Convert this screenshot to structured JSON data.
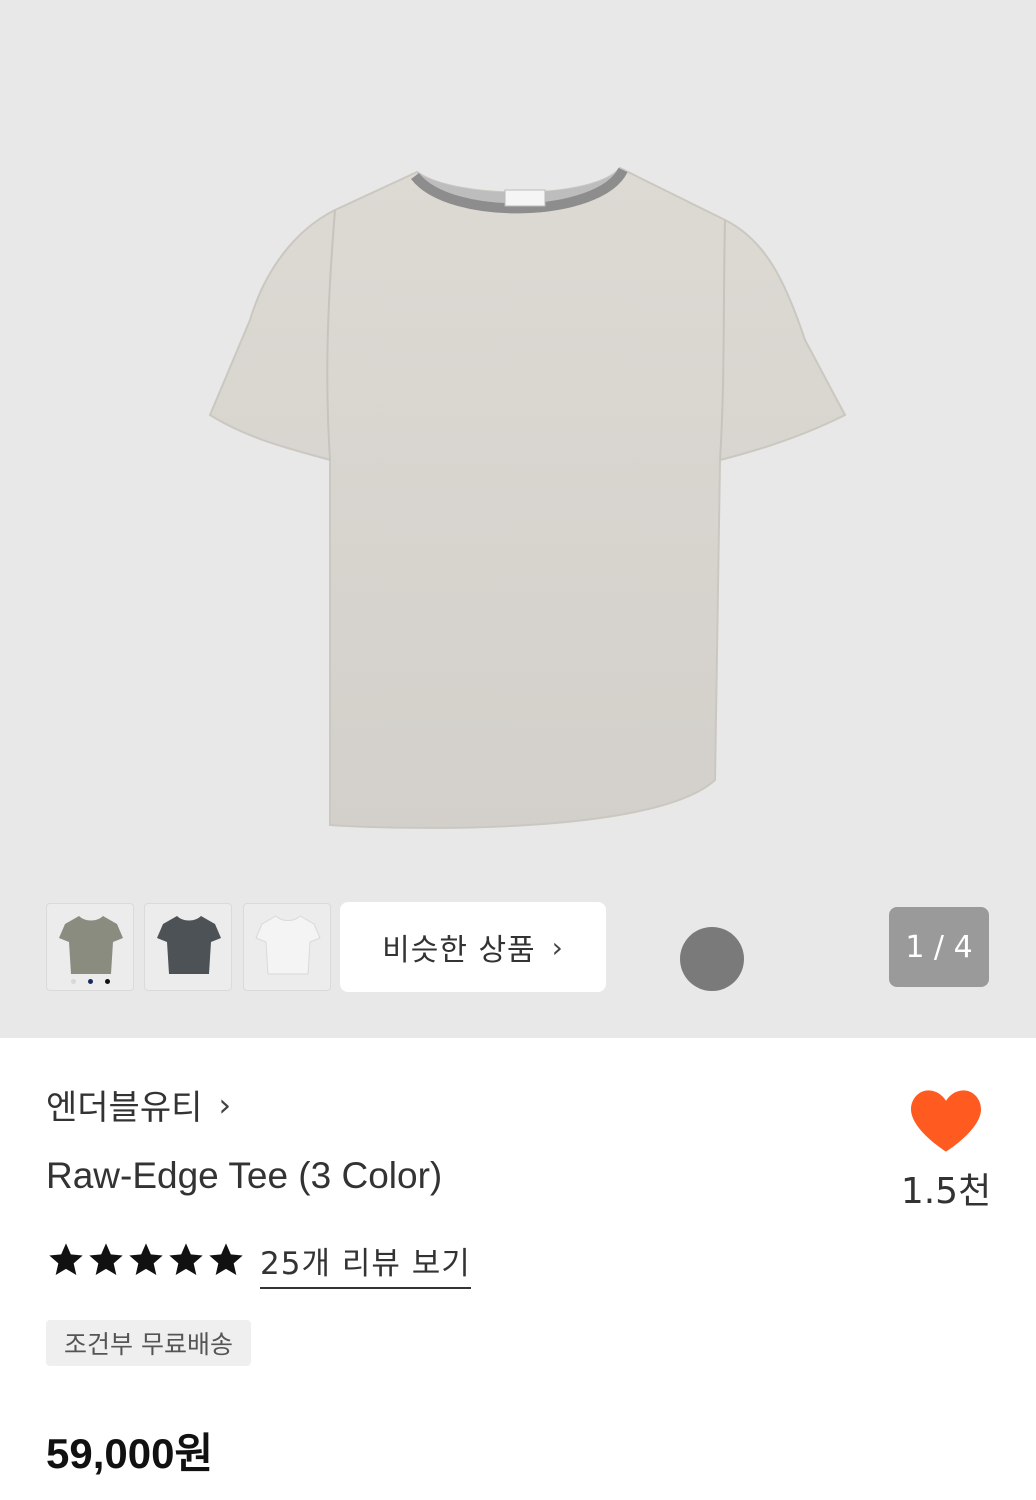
{
  "gallery": {
    "counter": "1 / 4",
    "similar_label": "비슷한 상품",
    "thumbnails": [
      {
        "name": "olive",
        "color": "#8a8c80"
      },
      {
        "name": "charcoal",
        "color": "#4d5256"
      },
      {
        "name": "white",
        "color": "#f4f4f4"
      }
    ],
    "thumb_dots": [
      "#d8d8d8",
      "#1b2a5e",
      "#111111"
    ]
  },
  "product": {
    "brand": "엔더블유티",
    "title": "Raw-Edge Tee (3 Color)",
    "rating_stars": 5,
    "review_link": "25개 리뷰 보기",
    "shipping_tag": "조건부 무료배송",
    "price": "59,000원"
  },
  "like": {
    "count": "1.5천",
    "color": "#ff5a1f"
  }
}
